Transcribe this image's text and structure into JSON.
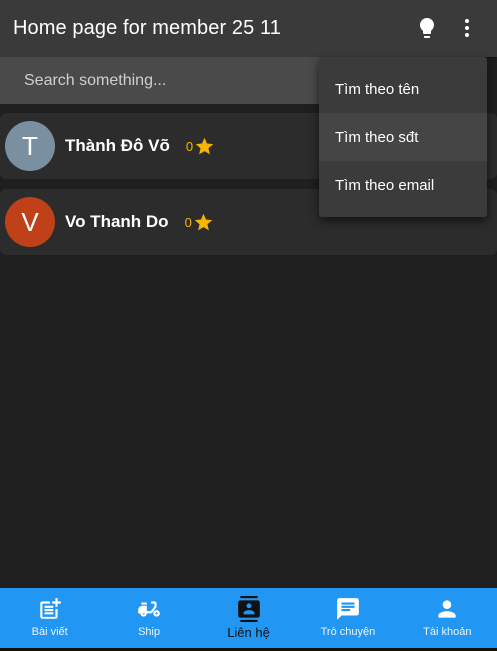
{
  "appbar": {
    "title": "Home page for member 25 11",
    "icons": [
      "lightbulb-icon",
      "more-vert-icon"
    ]
  },
  "search": {
    "placeholder": "Search something..."
  },
  "contacts": [
    {
      "initial": "T",
      "name": "Thành Đô Võ",
      "count": "0",
      "avatar_color": "#7a8fa0"
    },
    {
      "initial": "V",
      "name": "Vo Thanh Do",
      "count": "0",
      "avatar_color": "#c0401a"
    }
  ],
  "menu": {
    "items": [
      "Tìm theo tên",
      "Tìm theo sđt",
      "Tìm theo email"
    ]
  },
  "bottom_nav": {
    "active_index": 2,
    "items": [
      {
        "label": "Bài viết",
        "icon": "post-add-icon"
      },
      {
        "label": "Ship",
        "icon": "scooter-icon"
      },
      {
        "label": "Liên hệ",
        "icon": "contacts-icon"
      },
      {
        "label": "Trò chuyện",
        "icon": "chat-icon"
      },
      {
        "label": "Tài khoản",
        "icon": "person-icon"
      }
    ]
  },
  "colors": {
    "background": "#1f1f1f",
    "appbar": "#3a3a3a",
    "accent_blue": "#2196f3",
    "star": "#f7b500"
  }
}
